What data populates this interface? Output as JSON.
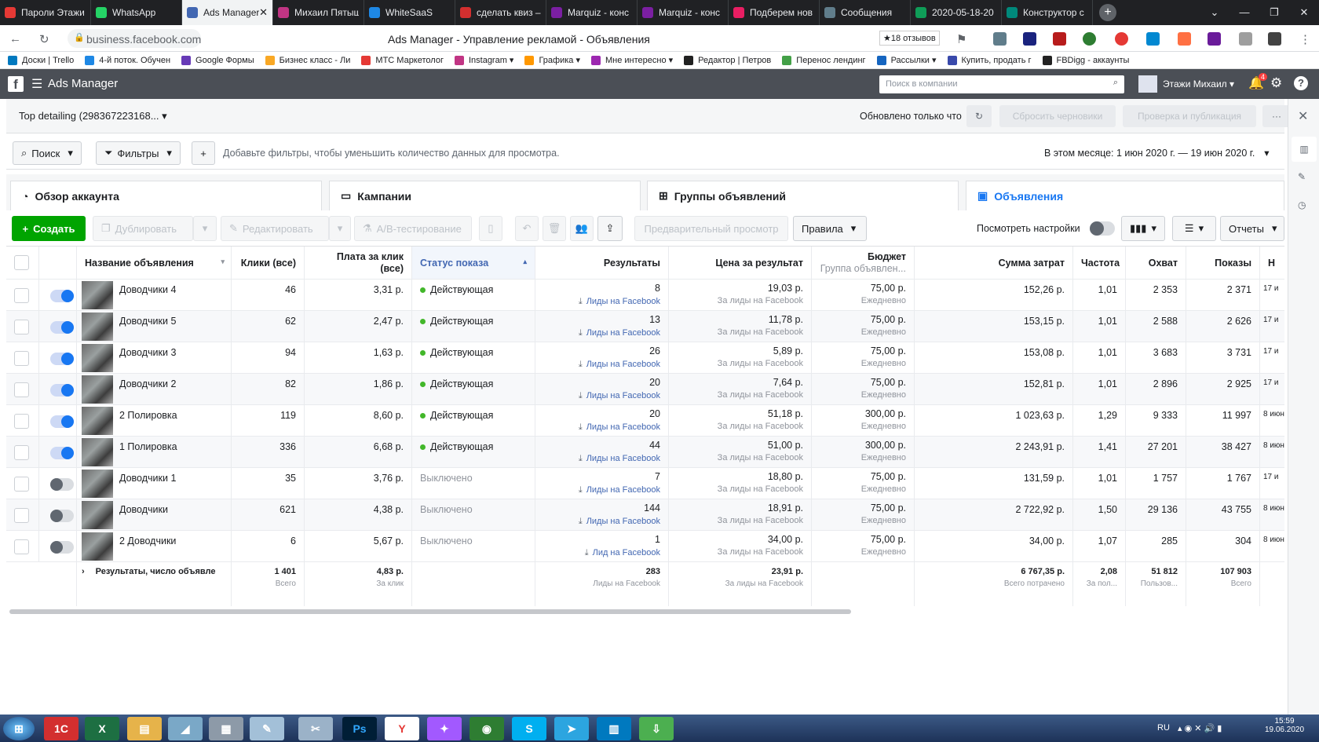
{
  "browser": {
    "tabs": [
      {
        "label": "Пароли Этажи",
        "color": "#e53935"
      },
      {
        "label": "WhatsApp",
        "color": "#25d366"
      },
      {
        "label": "Ads Manager",
        "color": "#4267b2",
        "active": true
      },
      {
        "label": "Михаил Пятыш",
        "color": "#c13584"
      },
      {
        "label": "WhiteSaaS",
        "color": "#1e88e5"
      },
      {
        "label": "сделать квиз –",
        "color": "#d32f2f"
      },
      {
        "label": "Marquiz - конс",
        "color": "#7b1fa2"
      },
      {
        "label": "Marquiz - конс",
        "color": "#7b1fa2"
      },
      {
        "label": "Подберем нов",
        "color": "#e91e63"
      },
      {
        "label": "Сообщения",
        "color": "#607d8b"
      },
      {
        "label": "2020-05-18-20",
        "color": "#0f9d58"
      },
      {
        "label": "Конструктор с",
        "color": "#00897b"
      }
    ],
    "close_glyph": "✕",
    "new_tab_glyph": "+",
    "url": "business.facebook.com",
    "page_title": "Ads Manager - Управление рекламой - Объявления",
    "reviews": "★18 отзывов",
    "bookmarks": [
      "Доски | Trello",
      "4-й поток. Обучен",
      "Google Формы",
      "Бизнес класс - Ли",
      "МТС Маркетолог",
      "Instagram ▾",
      "Графика ▾",
      "Мне интересно ▾",
      "Редактор | Петров",
      "Перенос лендинг",
      "Рассылки ▾",
      "Купить, продать г",
      "FBDigg - аккаунты"
    ]
  },
  "fb": {
    "app_name": "Ads Manager",
    "search_placeholder": "Поиск в компании",
    "user": "Этажи Михаил",
    "notif_count": "4"
  },
  "account": {
    "name": "Top detailing (298367223168...",
    "updated": "Обновлено только что",
    "discard": "Сбросить черновики",
    "publish": "Проверка и публикация",
    "more": "···"
  },
  "filters": {
    "search": "Поиск",
    "filters": "Фильтры",
    "hint": "Добавьте фильтры, чтобы уменьшить количество данных для просмотра.",
    "date": "В этом месяце: 1 июн 2020 г. — 19 июн 2020 г."
  },
  "tabs": {
    "overview": "Обзор аккаунта",
    "campaigns": "Кампании",
    "adsets": "Группы объявлений",
    "ads": "Объявления"
  },
  "toolbar": {
    "create": "Создать",
    "duplicate": "Дублировать",
    "edit": "Редактировать",
    "ab": "A/B-тестирование",
    "preview": "Предварительный просмотр",
    "rules": "Правила",
    "view_settings": "Посмотреть настройки",
    "reports": "Отчеты"
  },
  "columns": {
    "name": "Название объявления",
    "clicks": "Клики (все)",
    "cpc_1": "Плата за клик",
    "cpc_2": "(все)",
    "status": "Статус показа",
    "results": "Результаты",
    "cpr": "Цена за результат",
    "budget": "Бюджет",
    "budget_sub": "Группа объявлен...",
    "spend": "Сумма затрат",
    "freq": "Частота",
    "reach": "Охват",
    "impr": "Показы",
    "last": "Н"
  },
  "rows": [
    {
      "name": "Доводчики 4",
      "on": true,
      "clicks": "46",
      "cpc": "3,31 р.",
      "status": "Действующая",
      "active": true,
      "results": "8",
      "res_type": "Лиды на Facebook",
      "cpr": "19,03 р.",
      "cpr_sub": "За лиды на Facebook",
      "budget": "75,00 р.",
      "budget_sub": "Ежедневно",
      "spend": "152,26 р.",
      "freq": "1,01",
      "reach": "2 353",
      "impr": "2 371",
      "last": "17 и"
    },
    {
      "name": "Доводчики 5",
      "on": true,
      "clicks": "62",
      "cpc": "2,47 р.",
      "status": "Действующая",
      "active": true,
      "results": "13",
      "res_type": "Лиды на Facebook",
      "cpr": "11,78 р.",
      "cpr_sub": "За лиды на Facebook",
      "budget": "75,00 р.",
      "budget_sub": "Ежедневно",
      "spend": "153,15 р.",
      "freq": "1,01",
      "reach": "2 588",
      "impr": "2 626",
      "last": "17 и"
    },
    {
      "name": "Доводчики 3",
      "on": true,
      "clicks": "94",
      "cpc": "1,63 р.",
      "status": "Действующая",
      "active": true,
      "results": "26",
      "res_type": "Лиды на Facebook",
      "cpr": "5,89 р.",
      "cpr_sub": "За лиды на Facebook",
      "budget": "75,00 р.",
      "budget_sub": "Ежедневно",
      "spend": "153,08 р.",
      "freq": "1,01",
      "reach": "3 683",
      "impr": "3 731",
      "last": "17 и"
    },
    {
      "name": "Доводчики 2",
      "on": true,
      "clicks": "82",
      "cpc": "1,86 р.",
      "status": "Действующая",
      "active": true,
      "results": "20",
      "res_type": "Лиды на Facebook",
      "cpr": "7,64 р.",
      "cpr_sub": "За лиды на Facebook",
      "budget": "75,00 р.",
      "budget_sub": "Ежедневно",
      "spend": "152,81 р.",
      "freq": "1,01",
      "reach": "2 896",
      "impr": "2 925",
      "last": "17 и"
    },
    {
      "name": "2 Полировка",
      "on": true,
      "clicks": "119",
      "cpc": "8,60 р.",
      "status": "Действующая",
      "active": true,
      "results": "20",
      "res_type": "Лиды на Facebook",
      "cpr": "51,18 р.",
      "cpr_sub": "За лиды на Facebook",
      "budget": "300,00 р.",
      "budget_sub": "Ежедневно",
      "spend": "1 023,63 р.",
      "freq": "1,29",
      "reach": "9 333",
      "impr": "11 997",
      "last": "8 июн"
    },
    {
      "name": "1 Полировка",
      "on": true,
      "clicks": "336",
      "cpc": "6,68 р.",
      "status": "Действующая",
      "active": true,
      "results": "44",
      "res_type": "Лиды на Facebook",
      "cpr": "51,00 р.",
      "cpr_sub": "За лиды на Facebook",
      "budget": "300,00 р.",
      "budget_sub": "Ежедневно",
      "spend": "2 243,91 р.",
      "freq": "1,41",
      "reach": "27 201",
      "impr": "38 427",
      "last": "8 июн"
    },
    {
      "name": "Доводчики 1",
      "on": false,
      "clicks": "35",
      "cpc": "3,76 р.",
      "status": "Выключено",
      "active": false,
      "results": "7",
      "res_type": "Лиды на Facebook",
      "cpr": "18,80 р.",
      "cpr_sub": "За лиды на Facebook",
      "budget": "75,00 р.",
      "budget_sub": "Ежедневно",
      "spend": "131,59 р.",
      "freq": "1,01",
      "reach": "1 757",
      "impr": "1 767",
      "last": "17 и"
    },
    {
      "name": "Доводчики",
      "on": false,
      "clicks": "621",
      "cpc": "4,38 р.",
      "status": "Выключено",
      "active": false,
      "results": "144",
      "res_type": "Лиды на Facebook",
      "cpr": "18,91 р.",
      "cpr_sub": "За лиды на Facebook",
      "budget": "75,00 р.",
      "budget_sub": "Ежедневно",
      "spend": "2 722,92 р.",
      "freq": "1,50",
      "reach": "29 136",
      "impr": "43 755",
      "last": "8 июн"
    },
    {
      "name": "2 Доводчики",
      "on": false,
      "clicks": "6",
      "cpc": "5,67 р.",
      "status": "Выключено",
      "active": false,
      "results": "1",
      "res_type": "Лид на Facebook",
      "cpr": "34,00 р.",
      "cpr_sub": "За лиды на Facebook",
      "budget": "75,00 р.",
      "budget_sub": "Ежедневно",
      "spend": "34,00 р.",
      "freq": "1,07",
      "reach": "285",
      "impr": "304",
      "last": "8 июн"
    }
  ],
  "totals": {
    "label": "Результаты, число объявле",
    "clicks": "1 401",
    "clicks_sub": "Всего",
    "cpc": "4,83 р.",
    "cpc_sub": "За клик",
    "results": "283",
    "results_sub": "Лиды на Facebook",
    "cpr": "23,91 р.",
    "cpr_sub": "За лиды на Facebook",
    "spend": "6 767,35 р.",
    "spend_sub": "Всего потрачено",
    "freq": "2,08",
    "freq_sub": "За пол...",
    "reach": "51 812",
    "reach_sub": "Пользов...",
    "impr": "107 903",
    "impr_sub": "Всего"
  },
  "taskbar": {
    "lang": "RU",
    "time": "15:59",
    "date": "19.06.2020"
  }
}
